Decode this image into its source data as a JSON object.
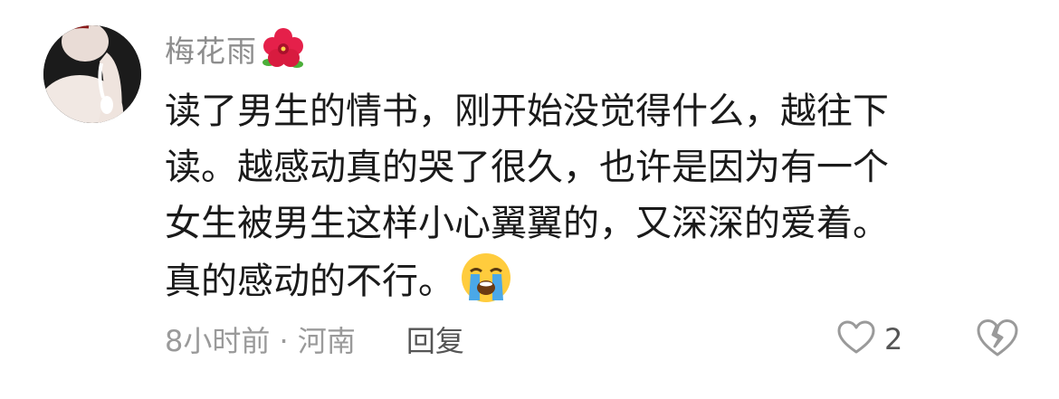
{
  "comment": {
    "username": "梅花雨",
    "username_emoji": "hibiscus-icon",
    "text_lines": [
      "读了男生的情书，刚开始没觉得什么，越往下",
      "读。越感动真的哭了很久，也许是因为有一个",
      "女生被男生这样小心翼翼的，又深深的爱着。",
      "真的感动的不行。"
    ],
    "text_trailing_emoji": "loudly-crying-face-icon",
    "meta": {
      "time_location": "8小时前 · 河南",
      "reply_label": "回复"
    },
    "actions": {
      "like_count": "2",
      "like_icon": "heart-outline-icon",
      "dislike_icon": "broken-heart-icon"
    }
  },
  "colors": {
    "username": "#8d8d8d",
    "text": "#1a1a1a",
    "meta": "#9a9a9a",
    "reply": "#555555"
  }
}
